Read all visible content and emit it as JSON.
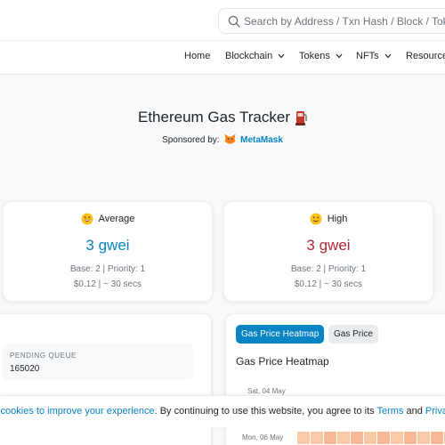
{
  "header": {
    "search_placeholder": "Search by Address / Txn Hash / Block / Token"
  },
  "nav": {
    "items": [
      {
        "label": "Home"
      },
      {
        "label": "Blockchain"
      },
      {
        "label": "Tokens"
      },
      {
        "label": "NFTs"
      },
      {
        "label": "Resources"
      }
    ]
  },
  "page": {
    "title": "Ethereum Gas Tracker",
    "sponsor_prefix": "Sponsored by:",
    "sponsor_name": "MetaMask"
  },
  "gas": {
    "average": {
      "label": "Average",
      "value": "3 gwei",
      "base_priority": "Base: 2 | Priority: 1",
      "cost": "$0.12 | ~ 30 secs",
      "color": "#0784c3"
    },
    "high": {
      "label": "High",
      "value": "3 gwei",
      "base_priority": "Base: 2 | Priority: 1",
      "cost": "$0.12 | ~ 30 secs",
      "color": "#b02a37"
    }
  },
  "pending": {
    "label": "PENDING QUEUE",
    "value": "165020"
  },
  "heatmap": {
    "tabs": [
      {
        "label": "Gas Price Heatmap",
        "active": true
      },
      {
        "label": "Gas Price",
        "active": false
      }
    ],
    "title": "Gas Price Heatmap",
    "rows": [
      "Sat, 04 May",
      "Mon, 06 May"
    ]
  },
  "cookie": {
    "text_before": "s cookies to improve your experience",
    "text_middle": ". By continuing to use this website, you agree to its ",
    "terms": "Terms",
    "and": " and ",
    "privacy": "Privacy Policy"
  },
  "icons": [
    "search-icon",
    "chevron-down-icon",
    "fuel-pump-icon",
    "metamask-fox-icon",
    "grinning-face-icon",
    "slight-smile-face-icon"
  ]
}
